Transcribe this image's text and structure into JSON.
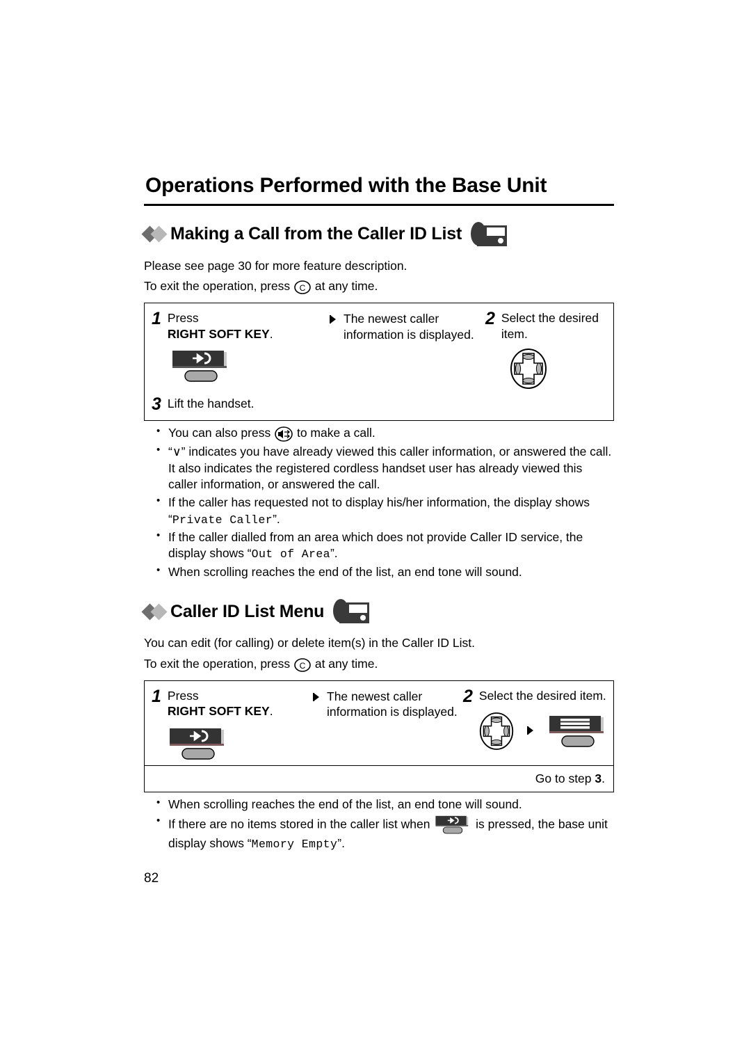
{
  "page": {
    "title": "Operations Performed with the Base Unit",
    "folio": "82"
  },
  "sections": [
    {
      "heading": "Making a Call from the Caller ID List",
      "heading_icon": "base-unit-icon",
      "intro": [
        "Please see page 30 for more feature description.",
        {
          "pre": "To exit the operation, press ",
          "icon": "cancel-key-icon",
          "post": " at any time."
        }
      ],
      "steps": {
        "step1_num": "1",
        "step1_text": "Press",
        "step1_strong": "RIGHT SOFT KEY",
        "step1_strong_suffix": ".",
        "step1_key_icon": "right-soft-key-icon",
        "arrow": "⮞",
        "result_line1": "The newest caller",
        "result_line2": "information is displayed.",
        "step2_num": "2",
        "step2_text": "Select the desired item.",
        "step2_key_icon": "navigator-key-icon",
        "step3_num": "3",
        "step3_text": "Lift the handset."
      },
      "bullets": [
        {
          "pre": "You can also press ",
          "icon": "speakerphone-key-icon",
          "post": " to make a call."
        },
        {
          "text": "“∨” indicates you have already viewed this caller information, or answered the call. It also indicates the registered cordless handset user has already viewed this caller information, or answered the call."
        },
        {
          "pre": "If the caller has requested not to display his/her information, the display shows “",
          "mono": "Private Caller",
          "post": "”."
        },
        {
          "pre": "If the caller dialled from an area which does not provide Caller ID service, the display shows “",
          "mono": "Out of Area",
          "post": "”."
        },
        {
          "text": "When scrolling reaches the end of the list, an end tone will sound."
        }
      ]
    },
    {
      "heading": "Caller ID List Menu",
      "heading_icon": "base-unit-icon",
      "intro": [
        "You can edit (for calling) or delete item(s) in the Caller ID List.",
        {
          "pre": "To exit the operation, press ",
          "icon": "cancel-key-icon",
          "post": " at any time."
        }
      ],
      "steps": {
        "step1_num": "1",
        "step1_text": "Press",
        "step1_strong": "RIGHT SOFT KEY",
        "step1_strong_suffix": ".",
        "step1_key_icon": "right-soft-key-icon",
        "arrow": "⮞",
        "result_line1": "The newest caller",
        "result_line2": "information is displayed.",
        "step2_num": "2",
        "step2_text": "Select the desired item.",
        "step2_key_icon": "navigator-key-icon",
        "step2_arrow": "⮞",
        "step2_key_icon2": "menu-soft-key-icon",
        "goto_pre": "Go to step ",
        "goto_num": "3",
        "goto_post": "."
      },
      "bullets": [
        {
          "text": "When scrolling reaches the end of the list, an end tone will sound."
        },
        {
          "pre": "If there are no items stored in the caller list when ",
          "icon": "right-soft-key-icon-inline",
          "mid": " is pressed, the base unit display shows “",
          "mono": "Memory Empty",
          "post": "”."
        }
      ]
    }
  ],
  "colors": {
    "ink": "#000000",
    "diamond_dark": "#6e6e6e",
    "diamond_light": "#b8b8b8",
    "key_dark": "#333333",
    "key_gray": "#a8a8a8"
  }
}
